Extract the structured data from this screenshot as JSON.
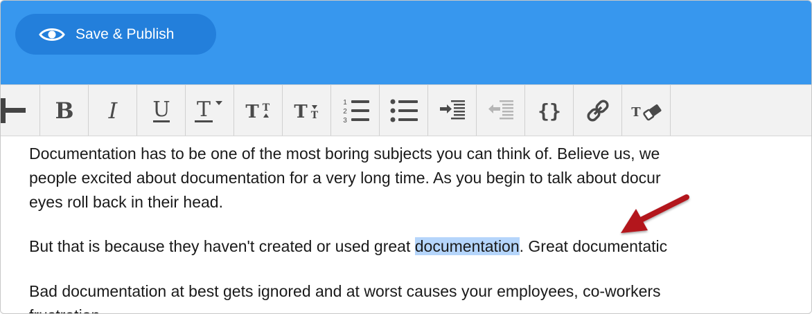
{
  "header": {
    "save_publish_label": "Save & Publish",
    "icon": "eye-icon",
    "background": "#3797ee"
  },
  "toolbar": {
    "buttons": [
      {
        "name": "add",
        "icon": "plus-icon"
      },
      {
        "name": "bold",
        "icon": "bold-icon",
        "glyph": "B"
      },
      {
        "name": "italic",
        "icon": "italic-icon",
        "glyph": "I"
      },
      {
        "name": "underline",
        "icon": "underline-icon",
        "glyph": "U"
      },
      {
        "name": "text-style",
        "icon": "text-style-icon",
        "glyph": "T"
      },
      {
        "name": "increase-font-size",
        "icon": "font-size-increase-icon",
        "glyph": "T"
      },
      {
        "name": "decrease-font-size",
        "icon": "font-size-decrease-icon",
        "glyph": "T"
      },
      {
        "name": "ordered-list",
        "icon": "ordered-list-icon",
        "numbers": [
          "1",
          "2",
          "3"
        ]
      },
      {
        "name": "unordered-list",
        "icon": "unordered-list-icon"
      },
      {
        "name": "indent",
        "icon": "indent-icon"
      },
      {
        "name": "outdent",
        "icon": "outdent-icon"
      },
      {
        "name": "code",
        "icon": "code-braces-icon",
        "glyph": "{}"
      },
      {
        "name": "link",
        "icon": "link-icon"
      },
      {
        "name": "clear-formatting",
        "icon": "clear-formatting-icon",
        "glyph": "T"
      }
    ]
  },
  "editor": {
    "paragraph1_line1": "Documentation has to be one of the most boring subjects you can think of. Believe us, we",
    "paragraph1_line2": "people excited about documentation for a very long time. As you begin to talk about docur",
    "paragraph1_line3": "eyes roll back in their head.",
    "paragraph2_before": "But that is because they haven't created or used great ",
    "paragraph2_selected": "documentation",
    "paragraph2_after": ". Great documentatic",
    "paragraph3_line1": "Bad documentation at best gets ignored and at worst causes your employees, co-workers",
    "paragraph3_line2": "frustration"
  },
  "annotation": {
    "icon": "red-arrow-annotation",
    "color": "#b3141d"
  }
}
